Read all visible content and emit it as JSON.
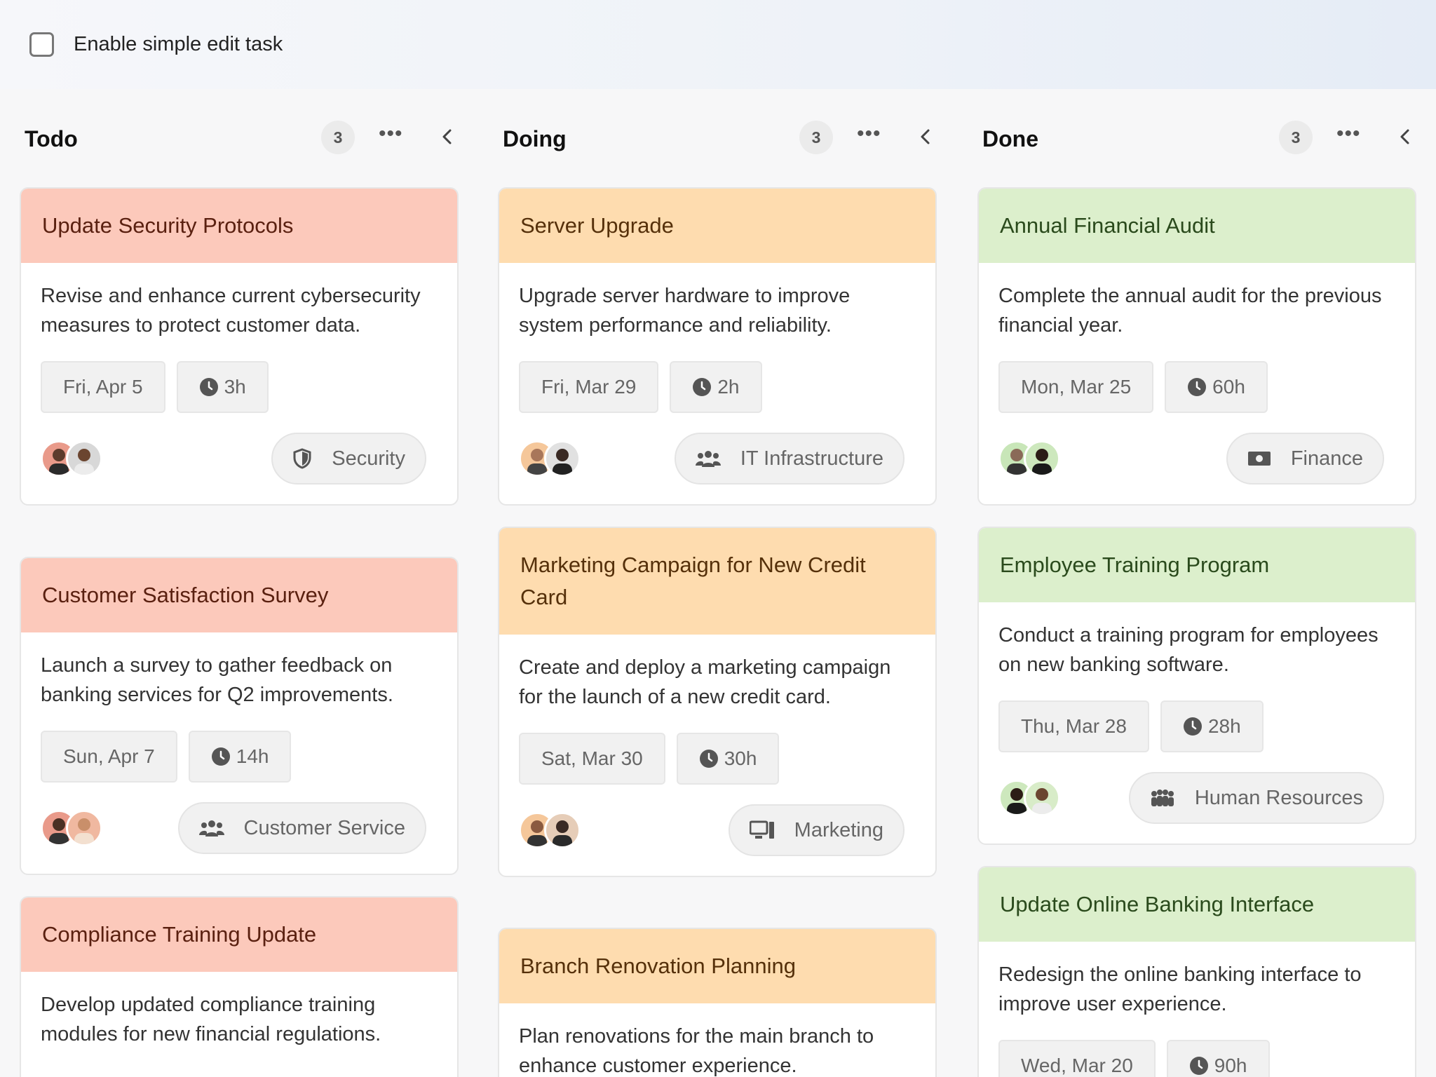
{
  "topbar": {
    "checkbox_label": "Enable simple edit task"
  },
  "columns": [
    {
      "title": "Todo",
      "count": "3",
      "cards": [
        {
          "title": "Update Security Protocols",
          "desc": "Revise and enhance current cybersecurity measures to protect customer data.",
          "date": "Fri, Apr 5",
          "hours": "3h",
          "tag": "Security",
          "tag_icon": "shield-icon"
        },
        {
          "title": "Customer Satisfaction Survey",
          "desc": "Launch a survey to gather feedback on banking services for Q2 improvements.",
          "date": "Sun, Apr 7",
          "hours": "14h",
          "tag": "Customer Service",
          "tag_icon": "users-icon"
        },
        {
          "title": "Compliance Training Update",
          "desc": "Develop updated compliance training modules for new financial regulations."
        }
      ]
    },
    {
      "title": "Doing",
      "count": "3",
      "cards": [
        {
          "title": "Server Upgrade",
          "desc": "Upgrade server hardware to improve system performance and reliability.",
          "date": "Fri, Mar 29",
          "hours": "2h",
          "tag": "IT Infrastructure",
          "tag_icon": "users-icon"
        },
        {
          "title": "Marketing Campaign for New Credit Card",
          "desc": "Create and deploy a marketing campaign for the launch of a new credit card.",
          "date": "Sat, Mar 30",
          "hours": "30h",
          "tag": "Marketing",
          "tag_icon": "desktop-icon"
        },
        {
          "title": "Branch Renovation Planning",
          "desc": "Plan renovations for the main branch to enhance customer experience."
        }
      ]
    },
    {
      "title": "Done",
      "count": "3",
      "cards": [
        {
          "title": "Annual Financial Audit",
          "desc": "Complete the annual audit for the previous financial year.",
          "date": "Mon, Mar 25",
          "hours": "60h",
          "tag": "Finance",
          "tag_icon": "money-icon"
        },
        {
          "title": "Employee Training Program",
          "desc": "Conduct a training program for employees on new banking software.",
          "date": "Thu, Mar 28",
          "hours": "28h",
          "tag": "Human Resources",
          "tag_icon": "people-icon"
        },
        {
          "title": "Update Online Banking Interface",
          "desc": "Redesign the online banking interface to improve user experience.",
          "date": "Wed, Mar 20",
          "hours": "90h"
        }
      ]
    }
  ],
  "colors": {
    "todo_head": "#fcc9bb",
    "doing_head": "#fedcaf",
    "done_head": "#dcefcc"
  }
}
